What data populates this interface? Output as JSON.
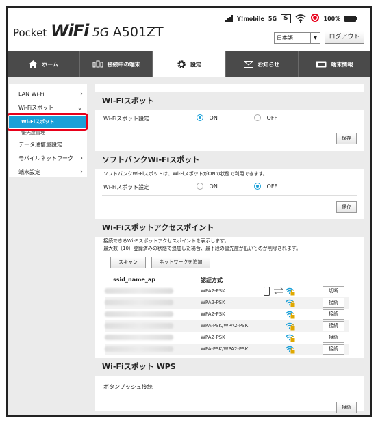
{
  "header": {
    "logo_pocket": "Pocket",
    "logo_wifi": "WiFi",
    "logo_5g": "5G",
    "logo_model": "A501ZT",
    "carrier": "Y!mobile",
    "network": "5G",
    "sim_badge": "S",
    "battery": "100%",
    "language": "日本語",
    "logout_label": "ログアウト"
  },
  "nav": {
    "tabs": [
      {
        "label": "ホーム",
        "icon": "home-icon",
        "active": false
      },
      {
        "label": "接続中の端末",
        "icon": "devices-icon",
        "active": false
      },
      {
        "label": "設定",
        "icon": "gear-icon",
        "active": true
      },
      {
        "label": "お知らせ",
        "icon": "mail-icon",
        "active": false
      },
      {
        "label": "端末情報",
        "icon": "device-info-icon",
        "active": false
      }
    ]
  },
  "sidebar": {
    "items": [
      {
        "label": "LAN Wi-Fi"
      },
      {
        "label": "Wi-Fiスポット"
      },
      {
        "label": "Wi-Fiスポット"
      },
      {
        "label": "優先度管理"
      },
      {
        "label": "データ通信量設定"
      },
      {
        "label": "モバイルネットワーク"
      },
      {
        "label": "端末設定"
      }
    ]
  },
  "wifispot": {
    "title": "Wi-Fiスポット",
    "setting_label": "Wi-Fiスポット設定",
    "on_label": "ON",
    "off_label": "OFF",
    "save_label": "保存"
  },
  "softbank": {
    "title": "ソフトバンクWi-Fiスポット",
    "note": "ソフトバンクWi-Fiスポットは、Wi-FiスポットがONの状態で利用できます。",
    "setting_label": "Wi-Fiスポット設定",
    "on_label": "ON",
    "off_label": "OFF",
    "save_label": "保存"
  },
  "access_point": {
    "title": "Wi-Fiスポットアクセスポイント",
    "desc1": "接続できるWi-Fiスポットアクセスポイントを表示します。",
    "desc2": "最大数（10）登録済みの状態で追加した場合、最下段の優先度が低いものが削除されます。",
    "scan_label": "スキャン",
    "add_label": "ネットワークを追加",
    "col_ssid": "ssid_name_ap",
    "col_auth": "認証方式",
    "rows": [
      {
        "auth": "WPA2-PSK",
        "action": "切断"
      },
      {
        "auth": "WPA2-PSK",
        "action": "接続"
      },
      {
        "auth": "WPA2-PSK",
        "action": "接続"
      },
      {
        "auth": "WPA-PSK/WPA2-PSK",
        "action": "接続"
      },
      {
        "auth": "WPA2-PSK",
        "action": "接続"
      },
      {
        "auth": "WPA-PSK/WPA2-PSK",
        "action": "接続"
      }
    ]
  },
  "wps": {
    "title": "Wi-Fiスポット WPS",
    "push_label": "ボタンプッシュ接続",
    "connect_label": "接続"
  },
  "colors": {
    "accent": "#1aa0d8",
    "nav_bg": "#4a4a4a",
    "highlight": "#e8001a",
    "lock": "#e0a800"
  }
}
